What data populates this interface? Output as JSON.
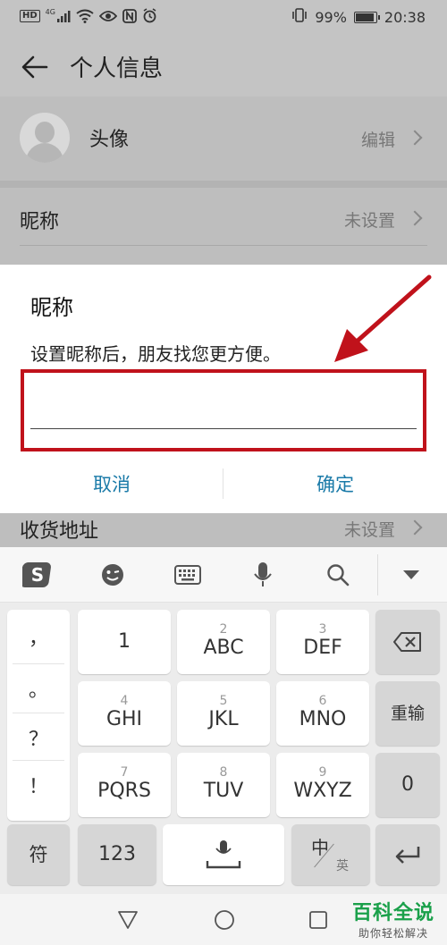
{
  "status_bar": {
    "left_icons": [
      "HD",
      "4G",
      "signal-icon",
      "wifi-icon",
      "eye-icon",
      "nfc-icon",
      "alarm-icon"
    ],
    "hd": "HD",
    "network": "4G",
    "battery": "99%",
    "time": "20:38"
  },
  "header": {
    "title": "个人信息"
  },
  "profile": {
    "avatar_label": "头像",
    "avatar_value": "编辑",
    "nickname_label": "昵称",
    "nickname_value": "未设置",
    "address_label": "收货地址",
    "address_value": "未设置"
  },
  "dialog": {
    "title": "昵称",
    "message": "设置昵称后，朋友找您更方便。",
    "input_value": "",
    "cancel": "取消",
    "confirm": "确定",
    "accent_color": "#1a7aa8"
  },
  "annotation": {
    "color": "#c0121b"
  },
  "keyboard": {
    "toolbar": [
      "sogou-logo-icon",
      "emoji-icon",
      "keyboard-icon",
      "mic-icon",
      "search-icon",
      "collapse-icon"
    ],
    "punctuation": [
      "，",
      "。",
      "？",
      "！"
    ],
    "keys": [
      {
        "num": "",
        "main": "1"
      },
      {
        "num": "2",
        "main": "ABC"
      },
      {
        "num": "3",
        "main": "DEF"
      },
      {
        "num": "4",
        "main": "GHI"
      },
      {
        "num": "5",
        "main": "JKL"
      },
      {
        "num": "6",
        "main": "MNO"
      },
      {
        "num": "7",
        "main": "PQRS"
      },
      {
        "num": "8",
        "main": "TUV"
      },
      {
        "num": "9",
        "main": "WXYZ"
      }
    ],
    "reenter": "重输",
    "zero": "0",
    "symbols": "符",
    "numbers": "123",
    "lang_primary": "中",
    "lang_secondary": "英"
  },
  "watermark": {
    "title": "百科全说",
    "subtitle": "助你轻松解决"
  }
}
